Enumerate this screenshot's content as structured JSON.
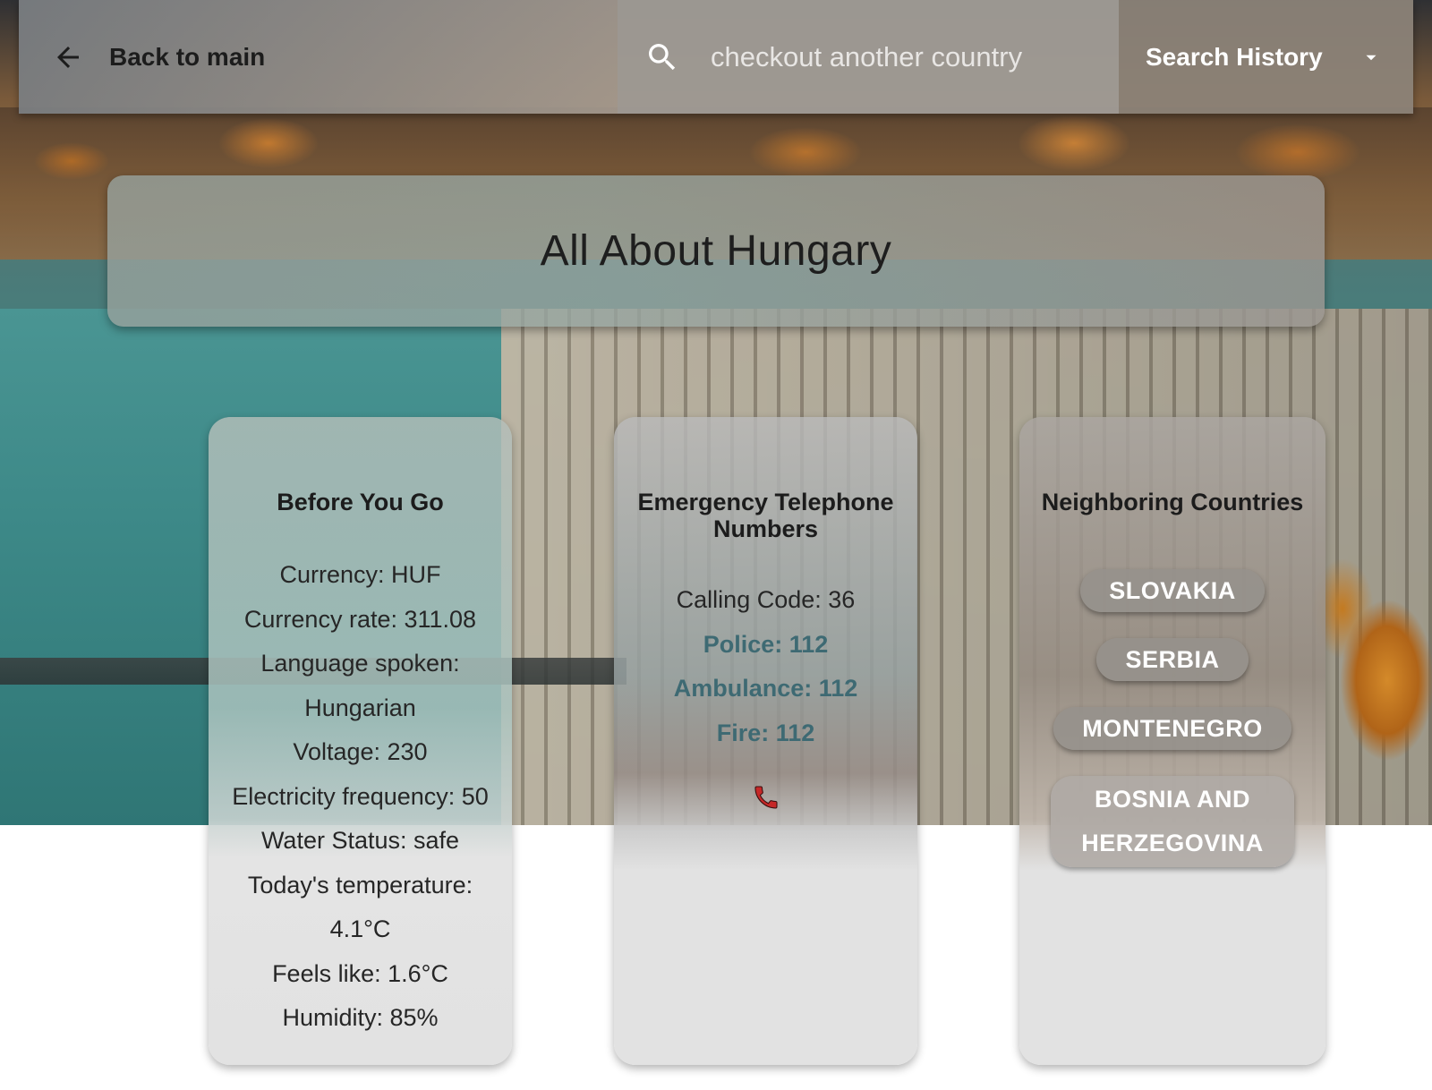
{
  "header": {
    "back_label": "Back to main",
    "search_placeholder": "checkout another country",
    "history_label": "Search History"
  },
  "page_title": "All About Hungary",
  "before_you_go": {
    "title": "Before You Go",
    "lines": [
      "Currency: HUF",
      "Currency rate: 311.08",
      "Language spoken:",
      "Hungarian",
      "Voltage: 230",
      "Electricity frequency: 50",
      "Water Status: safe",
      "Today's temperature:",
      "4.1°C",
      "Feels like: 1.6°C",
      "Humidity: 85%"
    ]
  },
  "emergency": {
    "title": "Emergency Telephone Numbers",
    "calling_code": "Calling Code: 36",
    "police": "Police: 112",
    "ambulance": "Ambulance: 112",
    "fire": "Fire: 112",
    "icon": "phone-icon"
  },
  "neighbors": {
    "title": "Neighboring Countries",
    "countries": [
      "SLOVAKIA",
      "SERBIA",
      "MONTENEGRO",
      "BOSNIA AND HERZEGOVINA"
    ]
  },
  "colors": {
    "link": "#3e6a73",
    "phone": "#c62828",
    "chip": "#968f8a"
  }
}
